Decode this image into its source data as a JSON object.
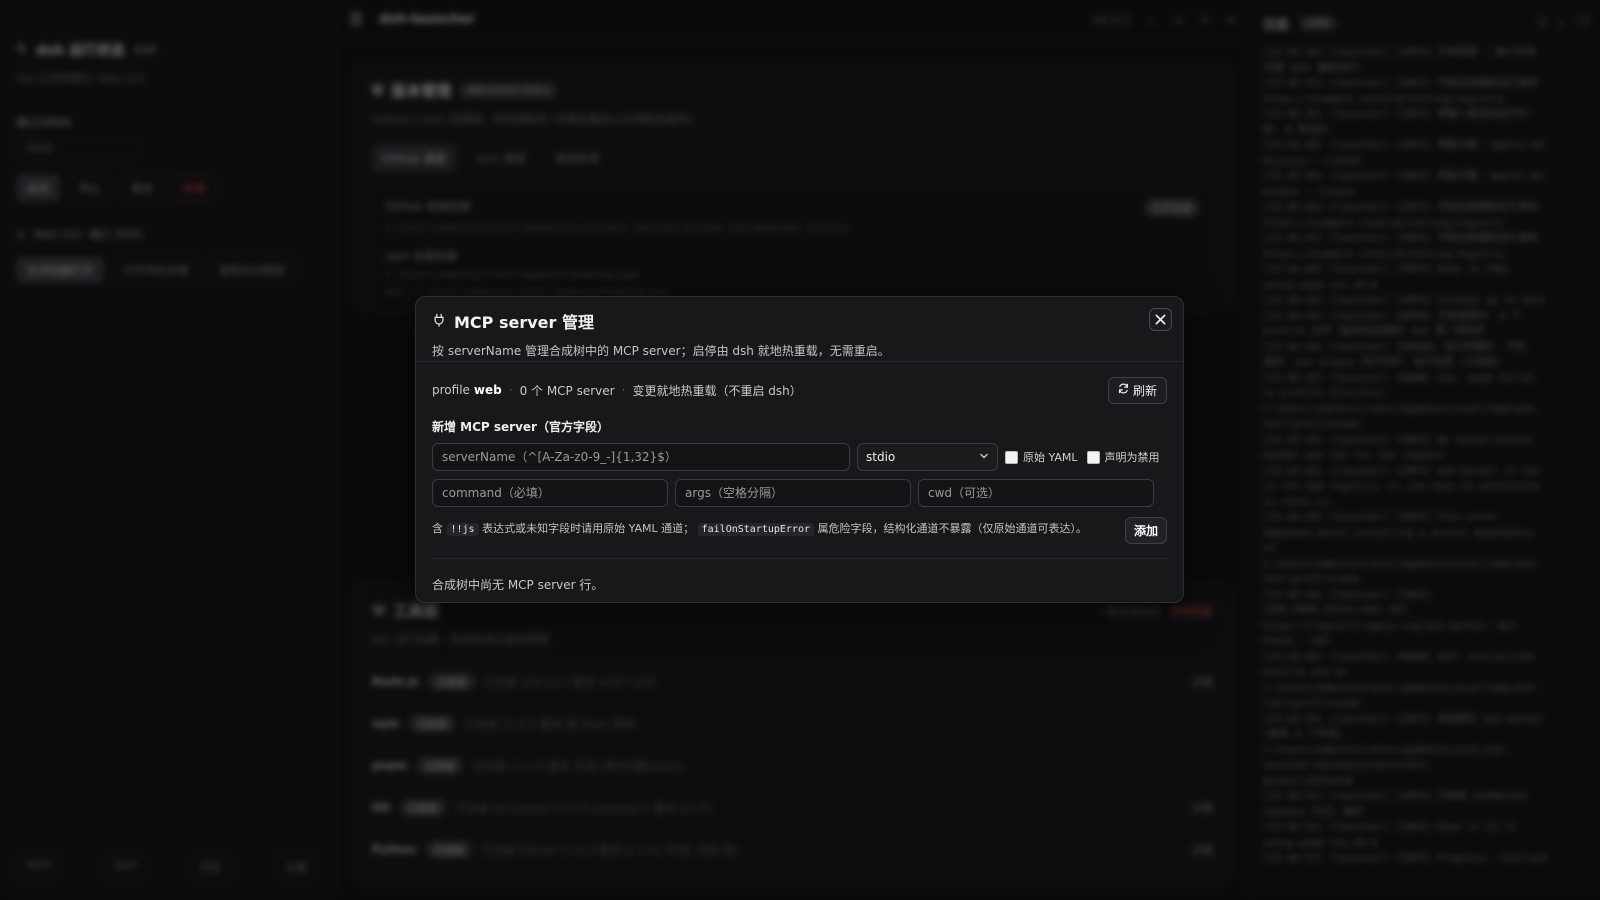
{
  "background": {
    "sidebar": {
      "app_title": "dsh 运行状态",
      "version": "#9ff",
      "subtitle": "dsh 生命周期与 Web GUI",
      "port_label": "端口(WEB)",
      "port_value": "3000",
      "buttons": [
        "启动",
        "停止",
        "重启",
        "终端"
      ],
      "web_label": "Web GUI",
      "web_port": "端口 3000",
      "web_buttons": [
        "在浏览器打开",
        "打开所在目录",
        "复制访问链接"
      ],
      "footer": [
        "MCP",
        "Skill",
        "日志",
        "主题"
      ]
    },
    "topbar": {
      "app_name": "dsh-launcher",
      "version": "v0.9.1"
    },
    "version_card": {
      "title": "版本管理",
      "badge": "dsh 0.9.0 / 0.8.1",
      "desc": "GitHub / npm 双通道，支持按版本 (切换会重启以应用新的版本)",
      "tabs": [
        "GitHub 通道",
        "npm 通道",
        "离线安装"
      ],
      "github_label": "GitHub 安装目录",
      "github_path": "C:\\Users\\Administrator\\AppData\\Local\\dsh-launcher\\github-dsh\\deepseek-harness",
      "npm_label": "npm 全局目录",
      "npm_path": "C:\\Users\\Administrator\\AppData\\Roaming\\npm",
      "npm_bin": "bin: C:\\Users\\Administrator\\AppData\\Roaming\\npm",
      "open_label": "打开目录"
    },
    "tools_card": {
      "title": "工具链",
      "desc": "dsh 运行依赖 · 自动检测与版本管理",
      "rows": [
        {
          "name": "Node.js",
          "badge": "已安装",
          "meta": "已安装 v20.12.2 要求 ≥18 / ≥20",
          "action": "详情"
        },
        {
          "name": "npm",
          "badge": "已安装",
          "meta": "已安装 11.6.2 要求 随 Node 提供",
          "action": ""
        },
        {
          "name": "pnpm",
          "badge": "已安装",
          "meta": "已安装 11.2.0 要求 可选 (用作内置pnpm)",
          "action": ""
        },
        {
          "name": "Git",
          "badge": "已安装",
          "meta": "已安装 git version 2.51.0.windows.1 要求 ≥2.3x",
          "action": "详情"
        },
        {
          "name": "Python",
          "badge": "已安装",
          "meta": "已安装 Python 3.14.3 要求 ≥ 3.1x (可选, 比较 用)",
          "action": "详情"
        }
      ],
      "actions": [
        "一键安装缺失",
        "清理残留"
      ]
    },
    "logs": {
      "title": "日志",
      "badge": "LIVE",
      "lines": [
        "[15:45:36] [launcher] [INFO] 开启回退 → 最小化现",
        "代理（dsh 重新运行）",
        "[15:46:23] [launcher] [INFO] 开始拉取最新运行清单",
        "https://example.invalid/tooling/registry",
        "[15:46:30] [launcher] [INFO] 把输入推送到运行时: ",
        "前: 0 条目的",
        "[15:46:40] [launcher] [INFO] 把配方置: agents-md",
        "missing → linked",
        "[15:46:40] [launcher] [INFO] 把配方置: agents-md",
        "broken → linked",
        "[15:46:40] [launcher] [INFO] 开始拉取最新运行清单",
        "https://example.invalid/tooling/registry",
        "[15:46:42] [launcher] [INFO] 开始拉取最新运行清单",
        "https://example.invalid/tooling/registry",
        "[15:46:46] [launcher] [INFO] Done in 29ms",
        "using pnpm v11.20.0",
        "[15:46:49] [launcher] [INFO] Already up to date",
        "[15:46:49] [launcher] [WARN] 已安装提示: 0 个",
        "profile 文件（版本先前更新）dsh 第一项同步",
        "[15:46:49] [launcher] [ERROR] 运行时期后: 不知",
        "道的: dsh plugin 执行完毕: 运行完成 (已安装)",
        "[15:46:49] [launcher] [WARN] dsh: pnpm failed",
        "to profile directory",
        "C:\\Users\\Administrator\\AppData\\Local\\Temp\\dsh-",
        "tool\\profile\\web",
        "[15:46:49] [launcher] [INFO] No authorization",
        "header was set for the request.",
        "[15:46:49] [launcher] [INFO] dsh-market is not",
        "in the npm registry, or you have no permission",
        "to fetch it.",
        "[15:46:49] [launcher] [INFO] This error",
        "happened while installing a direct dependency",
        "of",
        "C:\\Users\\Administrator\\AppData\\Local\\Temp\\dsh-",
        "tool\\profile\\web",
        "[15:46:49] [launcher] [INFO]",
        "[ERR_PNPM_FETCH_404] GET",
        "https://registry.npmjs.org/dsh-market: Not",
        "Found - 404",
        "[15:46:50] [launcher] [WARN] dsh: initialized",
        "profile web at",
        "C:\\Users\\Administrator\\AppData\\Local\\Temp\\dsh-",
        "tool\\profile\\web",
        "[15:46:50] [launcher] [INFO] 安装提示 dsh-market",
        "(版本 0 个市场)",
        "C:\\Users\\Administrator\\AppData\\Local\\dsh-",
        "launcher\\backup\\plugins\\dsh-",
        "market\\20251030",
        "[15:46:51] [launcher] [INFO] 已安装 dshMarket",
        "(bundle 方式) 插件",
        "[15:46:51] [launcher] [INFO] Done in 15.7s",
        "using pnpm v11.20.0",
        "[15:46:51] [launcher] [INFO] Progress: resolved"
      ]
    }
  },
  "modal": {
    "title": "MCP server 管理",
    "description": "按 serverName 管理合成树中的 MCP server；启停由 dsh 就地热重载，无需重启。",
    "close_icon": "close-icon",
    "profile_prefix": "profile",
    "profile_name": "web",
    "server_count": "0 个 MCP server",
    "reload_note": "变更就地热重载（不重启 dsh）",
    "refresh_label": "刷新",
    "section_title": "新增 MCP server（官方字段）",
    "server_name_placeholder": "serverName（^[A-Za-z0-9_-]{1,32}$）",
    "transport_value": "stdio",
    "raw_yaml_label": "原始 YAML",
    "disabled_label": "声明为禁用",
    "command_placeholder": "command（必填）",
    "args_placeholder": "args（空格分隔）",
    "cwd_placeholder": "cwd（可选）",
    "hint_part1": "含",
    "hint_code1": "!!js",
    "hint_part2": "表达式或未知字段时请用原始 YAML 通道；",
    "hint_code2": "failOnStartupError",
    "hint_part3": "属危险字段，结构化通道不暴露（仅原始通道可表达）。",
    "add_label": "添加",
    "empty_text": "合成树中尚无 MCP server 行。"
  }
}
